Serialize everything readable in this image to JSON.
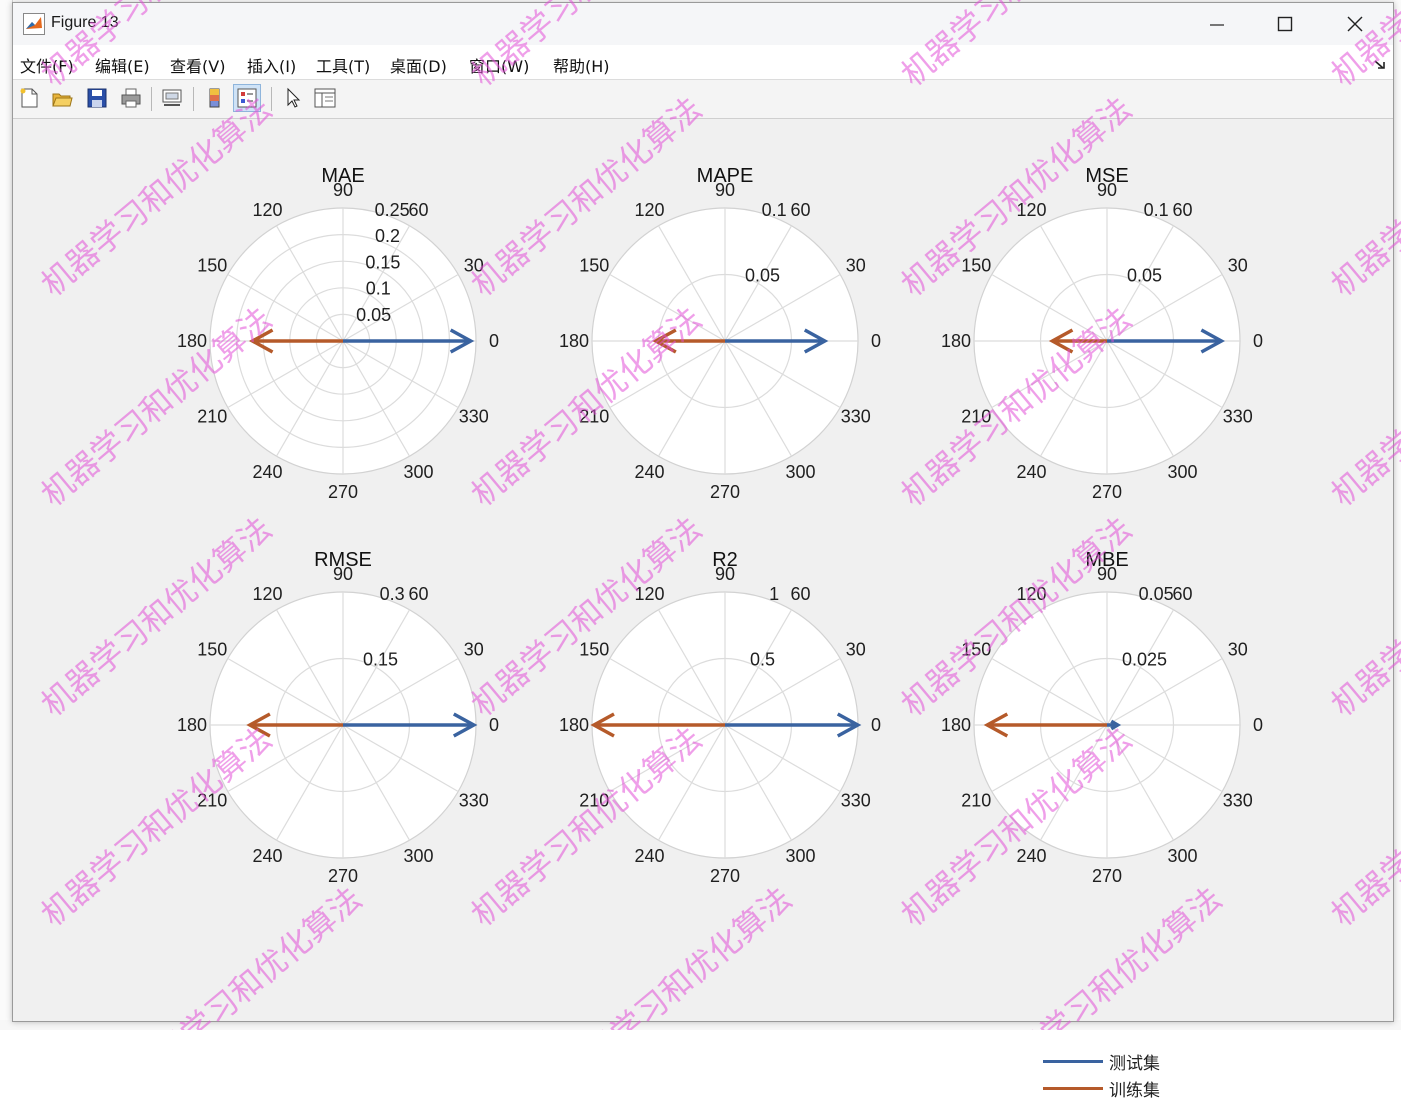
{
  "window": {
    "title": "Figure 13",
    "minimize_icon": "minimize-icon",
    "maximize_icon": "maximize-icon",
    "close_icon": "close-icon"
  },
  "menu": {
    "items": [
      "文件(F)",
      "编辑(E)",
      "查看(V)",
      "插入(I)",
      "工具(T)",
      "桌面(D)",
      "窗口(W)",
      "帮助(H)"
    ],
    "dock_icon": "dock-arrow-icon"
  },
  "toolbar": {
    "buttons": [
      {
        "icon": "new-figure-icon"
      },
      {
        "icon": "open-file-icon"
      },
      {
        "icon": "save-icon"
      },
      {
        "icon": "print-icon"
      },
      {
        "icon": "link-plot-icon"
      },
      {
        "icon": "insert-colorbar-icon"
      },
      {
        "icon": "insert-legend-icon",
        "active": true
      },
      {
        "icon": "edit-plot-pointer-icon"
      },
      {
        "icon": "property-inspector-icon"
      }
    ]
  },
  "chart_data": [
    {
      "type": "polar",
      "title": "MAE",
      "rticks": [
        "0.05",
        "0.1",
        "0.15",
        "0.2",
        "0.25"
      ],
      "rmax": 0.25,
      "angle_labels": [
        "0",
        "30",
        "60",
        "90",
        "120",
        "150",
        "180",
        "210",
        "240",
        "270",
        "300",
        "330"
      ],
      "series": [
        {
          "value": 0.24,
          "angle": 0
        },
        {
          "value": 0.17,
          "angle": 180
        }
      ]
    },
    {
      "type": "polar",
      "title": "MAPE",
      "rticks": [
        "0.05",
        "0.1"
      ],
      "rmax": 0.1,
      "angle_labels": [
        "0",
        "30",
        "60",
        "90",
        "120",
        "150",
        "180",
        "210",
        "240",
        "270",
        "300",
        "330"
      ],
      "series": [
        {
          "value": 0.075,
          "angle": 0
        },
        {
          "value": 0.052,
          "angle": 180
        }
      ]
    },
    {
      "type": "polar",
      "title": "MSE",
      "rticks": [
        "0.05",
        "0.1"
      ],
      "rmax": 0.1,
      "angle_labels": [
        "0",
        "30",
        "60",
        "90",
        "120",
        "150",
        "180",
        "210",
        "240",
        "270",
        "300",
        "330"
      ],
      "series": [
        {
          "value": 0.086,
          "angle": 0
        },
        {
          "value": 0.041,
          "angle": 180
        }
      ]
    },
    {
      "type": "polar",
      "title": "RMSE",
      "rticks": [
        "0.15",
        "0.3"
      ],
      "rmax": 0.3,
      "angle_labels": [
        "0",
        "30",
        "60",
        "90",
        "120",
        "150",
        "180",
        "210",
        "240",
        "270",
        "300",
        "330"
      ],
      "series": [
        {
          "value": 0.295,
          "angle": 0
        },
        {
          "value": 0.21,
          "angle": 180
        }
      ]
    },
    {
      "type": "polar",
      "title": "R2",
      "rticks": [
        "0.5",
        "1"
      ],
      "rmax": 1,
      "angle_labels": [
        "0",
        "30",
        "60",
        "90",
        "120",
        "150",
        "180",
        "210",
        "240",
        "270",
        "300",
        "330"
      ],
      "series": [
        {
          "value": 0.998,
          "angle": 0
        },
        {
          "value": 0.985,
          "angle": 180
        }
      ]
    },
    {
      "type": "polar",
      "title": "MBE",
      "rticks": [
        "0.025",
        "0.05"
      ],
      "rmax": 0.05,
      "angle_labels": [
        "0",
        "30",
        "60",
        "90",
        "120",
        "150",
        "180",
        "210",
        "240",
        "270",
        "300",
        "330"
      ],
      "series": [
        {
          "value": 0.004,
          "angle": 0
        },
        {
          "value": 0.045,
          "angle": 180
        }
      ]
    }
  ],
  "legend": {
    "entries": [
      {
        "label": "测试集",
        "color": "#3a63a0"
      },
      {
        "label": "训练集",
        "color": "#b55a2a"
      }
    ],
    "placement": "bottom-right"
  },
  "colors": {
    "test": "#3a63a0",
    "train": "#b55a2a"
  },
  "watermark": "机器学习和优化算法"
}
